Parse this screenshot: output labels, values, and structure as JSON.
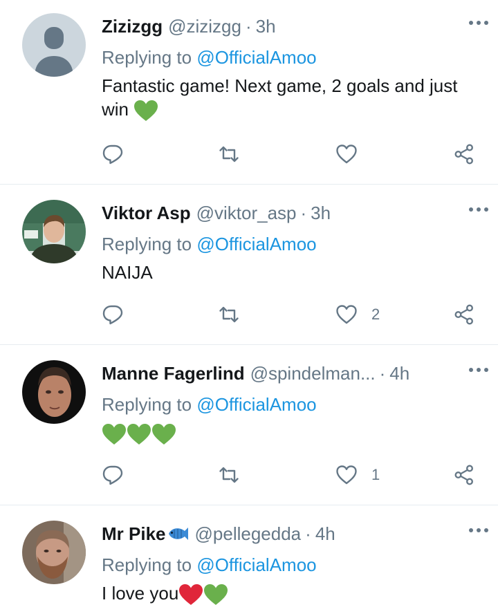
{
  "tweets": [
    {
      "name": "Zizizgg",
      "handle": "@zizizgg",
      "time": "3h",
      "replying_prefix": "Replying to",
      "replying_to": "@OfficialAmoo",
      "text": "Fantastic game! Next game, 2 goals and just win",
      "emoji": [
        "green-heart"
      ],
      "likes": ""
    },
    {
      "name": "Viktor Asp",
      "handle": "@viktor_asp",
      "time": "3h",
      "replying_prefix": "Replying to",
      "replying_to": "@OfficialAmoo",
      "text": "NAIJA",
      "likes": "2"
    },
    {
      "name": "Manne Fagerlind",
      "handle": "@spindelman...",
      "time": "4h",
      "replying_prefix": "Replying to",
      "replying_to": "@OfficialAmoo",
      "text": "",
      "emoji": [
        "green-heart",
        "green-heart",
        "green-heart"
      ],
      "likes": "1"
    },
    {
      "name": "Mr Pike",
      "name_emoji": "fish",
      "handle": "@pellegedda",
      "time": "4h",
      "replying_prefix": "Replying to",
      "replying_to": "@OfficialAmoo",
      "text": "I love you",
      "emoji": [
        "red-heart",
        "green-heart"
      ]
    }
  ],
  "colors": {
    "link": "#1b95e0",
    "secondary_text": "#657786",
    "green_heart": "#6ab04c",
    "red_heart": "#e0263a"
  },
  "icons": {
    "more": "more-dots-icon",
    "reply": "reply-icon",
    "retweet": "retweet-icon",
    "like": "like-heart-icon",
    "share": "share-icon"
  }
}
